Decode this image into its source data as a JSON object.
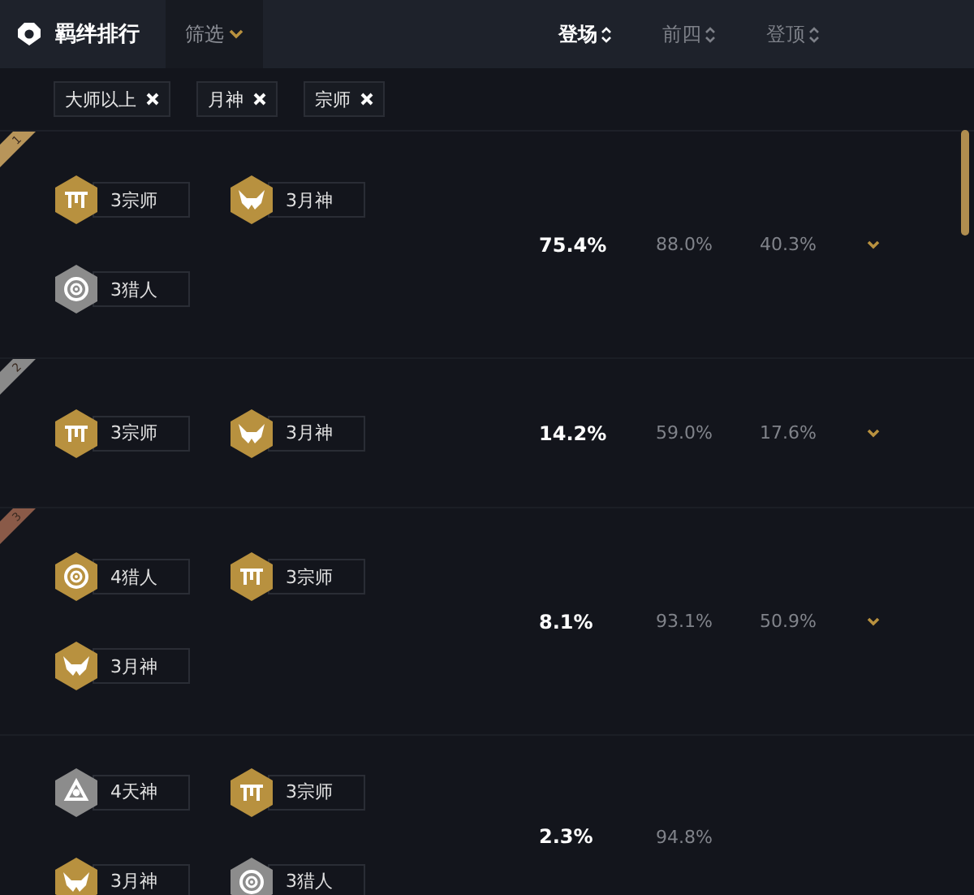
{
  "header": {
    "title": "羁绊排行",
    "filter_button": "筛选",
    "columns": [
      {
        "label": "登场",
        "selected": true
      },
      {
        "label": "前四",
        "selected": false
      },
      {
        "label": "登顶",
        "selected": false
      }
    ]
  },
  "filters": [
    "大师以上",
    "月神",
    "宗师"
  ],
  "rows": [
    {
      "rank": "1",
      "color": "#b8955a",
      "traits": [
        {
          "kind": "temple",
          "color": "#b8913f",
          "label": "3宗师"
        },
        {
          "kind": "horns",
          "color": "#b8913f",
          "label": "3月神"
        },
        {
          "kind": "target",
          "color": "#8c8c8c",
          "label": "3猎人"
        }
      ],
      "appear": "75.4%",
      "top4": "88.0%",
      "top1": "40.3%"
    },
    {
      "rank": "2",
      "color": "#8a8a8a",
      "traits": [
        {
          "kind": "temple",
          "color": "#b8913f",
          "label": "3宗师"
        },
        {
          "kind": "horns",
          "color": "#b8913f",
          "label": "3月神"
        }
      ],
      "appear": "14.2%",
      "top4": "59.0%",
      "top1": "17.6%"
    },
    {
      "rank": "3",
      "color": "#8a5a48",
      "traits": [
        {
          "kind": "target",
          "color": "#b8913f",
          "label": "4猎人"
        },
        {
          "kind": "temple",
          "color": "#b8913f",
          "label": "3宗师"
        },
        {
          "kind": "horns",
          "color": "#b8913f",
          "label": "3月神"
        }
      ],
      "appear": "8.1%",
      "top4": "93.1%",
      "top1": "50.9%"
    },
    {
      "traits": [
        {
          "kind": "tri",
          "color": "#8c8c8c",
          "label": "4天神"
        },
        {
          "kind": "temple",
          "color": "#b8913f",
          "label": "3宗师"
        },
        {
          "kind": "horns",
          "color": "#b8913f",
          "label": "3月神"
        },
        {
          "kind": "target",
          "color": "#8c8c8c",
          "label": "3猎人"
        }
      ],
      "appear": "2.3%",
      "top4": "94.8%"
    }
  ]
}
